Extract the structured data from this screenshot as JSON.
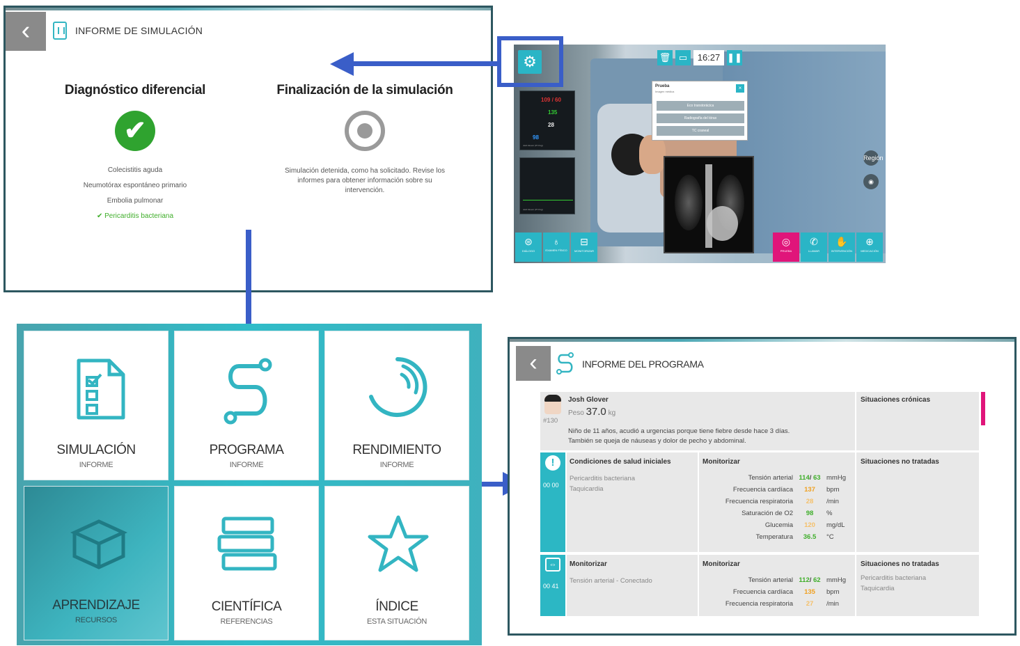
{
  "sim_report": {
    "title": "INFORME DE SIMULACIÓN",
    "back_icon": "chevron-left-icon",
    "diff_dx": {
      "heading": "Diagnóstico diferencial",
      "items": [
        "Colecistitis aguda",
        "Neumotórax espontáneo primario",
        "Embolia pulmonar"
      ],
      "correct": "Pericarditis bacteriana"
    },
    "end": {
      "heading": "Finalización de la simulación",
      "text": "Simulación detenida, como ha solicitado. Revise los informes para obtener información sobre su intervención."
    }
  },
  "simulation": {
    "timer": "16:27",
    "monitor": {
      "bp": "109 / 60",
      "hr": "135",
      "rr": "28",
      "spo2": "98",
      "patient": "Josh Glover (37.0 kg)"
    },
    "popup": {
      "title": "Prueba",
      "subtitle": "Imagen médica",
      "options": [
        "Eco transtorácica",
        "Radiografía del tórax",
        "TC craneal"
      ]
    },
    "bottom_left": [
      "DIÁLOGO",
      "EXAMEN FÍSICO",
      "MONITORIZAR"
    ],
    "bottom_right": [
      "PRUEBA",
      "LLAMAR",
      "INTERVENCIÓN",
      "MEDICACIÓN"
    ],
    "side_label": "Región"
  },
  "menu": {
    "tiles": [
      {
        "title": "SIMULACIÓN",
        "sub": "INFORME"
      },
      {
        "title": "PROGRAMA",
        "sub": "INFORME"
      },
      {
        "title": "RENDIMIENTO",
        "sub": "INFORME"
      },
      {
        "title": "APRENDIZAJE",
        "sub": "RECURSOS"
      },
      {
        "title": "CIENTÍFICA",
        "sub": "REFERENCIAS"
      },
      {
        "title": "ÍNDICE",
        "sub": "ESTA SITUACIÓN"
      }
    ]
  },
  "program_report": {
    "title": "INFORME DEL PROGRAMA",
    "patient": {
      "name": "Josh Glover",
      "weight_label": "Peso",
      "weight_value": "37.0",
      "weight_unit": "kg",
      "id": "#130",
      "desc1": "Niño de 11 años, acudió a urgencias porque tiene fiebre desde hace 3 días.",
      "desc2": "También se queja de náuseas y dolor de pecho y abdominal."
    },
    "chronic_label": "Situaciones crónicas",
    "row1": {
      "time": "00 00",
      "col1_title": "Condiciones de salud iniciales",
      "col1_items": [
        "Pericarditis bacteriana",
        "Taquicardia"
      ],
      "col2_title": "Monitorizar",
      "col3_title": "Situaciones no tratadas",
      "vitals": [
        {
          "label": "Tensión arterial",
          "v1": "114",
          "sep": "/",
          "v2": "63",
          "unit": "mmHg"
        },
        {
          "label": "Frecuencia cardíaca",
          "v1": "137",
          "unit": "bpm"
        },
        {
          "label": "Frecuencia respiratoria",
          "v1": "28",
          "unit": "/min"
        },
        {
          "label": "Saturación de O2",
          "v1": "98",
          "unit": "%"
        },
        {
          "label": "Glucemia",
          "v1": "120",
          "unit": "mg/dL"
        },
        {
          "label": "Temperatura",
          "v1": "36.5",
          "unit": "°C"
        }
      ]
    },
    "row2": {
      "time": "00 41",
      "col1_title": "Monitorizar",
      "col1_items": [
        "Tensión arterial - Conectado"
      ],
      "col2_title": "Monitorizar",
      "col3_title": "Situaciones no tratadas",
      "col3_items": [
        "Pericarditis bacteriana",
        "Taquicardia"
      ],
      "vitals": [
        {
          "label": "Tensión arterial",
          "v1": "112",
          "sep": "/",
          "v2": "62",
          "unit": "mmHg"
        },
        {
          "label": "Frecuencia cardíaca",
          "v1": "135",
          "unit": "bpm"
        },
        {
          "label": "Frecuencia respiratoria",
          "v1": "27",
          "unit": "/min"
        }
      ]
    }
  },
  "colors": {
    "teal": "#2cb7c4",
    "arrow_blue": "#3a5ec8",
    "green": "#2fa32f",
    "orange": "#f0a020",
    "magenta": "#e0157a"
  }
}
